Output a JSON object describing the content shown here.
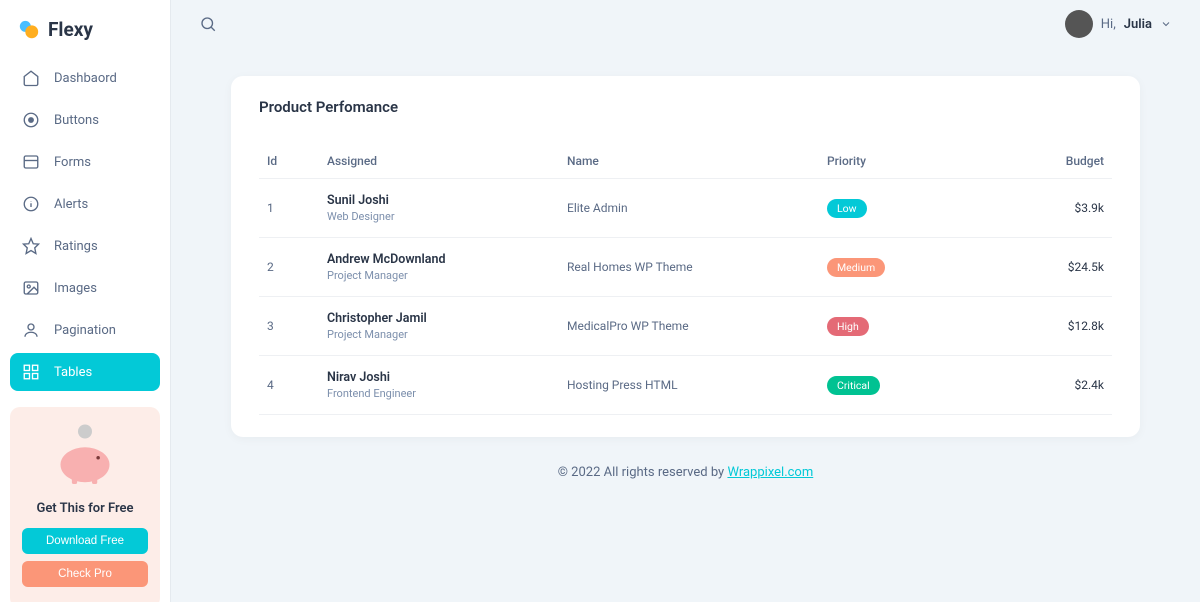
{
  "brand": "Flexy",
  "sidebar": {
    "items": [
      {
        "label": "Dashbaord",
        "icon": "home"
      },
      {
        "label": "Buttons",
        "icon": "target"
      },
      {
        "label": "Forms",
        "icon": "layout"
      },
      {
        "label": "Alerts",
        "icon": "info"
      },
      {
        "label": "Ratings",
        "icon": "star"
      },
      {
        "label": "Images",
        "icon": "image"
      },
      {
        "label": "Pagination",
        "icon": "user"
      },
      {
        "label": "Tables",
        "icon": "grid"
      }
    ],
    "active_index": 7,
    "promo": {
      "title": "Get This for Free",
      "download": "Download Free",
      "check": "Check Pro"
    }
  },
  "header": {
    "greeting": "Hi,",
    "username": "Julia"
  },
  "card": {
    "title": "Product Perfomance",
    "columns": [
      "Id",
      "Assigned",
      "Name",
      "Priority",
      "Budget"
    ],
    "rows": [
      {
        "id": "1",
        "name": "Sunil Joshi",
        "role": "Web Designer",
        "project": "Elite Admin",
        "priority": "Low",
        "priority_color": "#03c9d7",
        "budget": "$3.9k"
      },
      {
        "id": "2",
        "name": "Andrew McDownland",
        "role": "Project Manager",
        "project": "Real Homes WP Theme",
        "priority": "Medium",
        "priority_color": "#fb9678",
        "budget": "$24.5k"
      },
      {
        "id": "3",
        "name": "Christopher Jamil",
        "role": "Project Manager",
        "project": "MedicalPro WP Theme",
        "priority": "High",
        "priority_color": "#e46a76",
        "budget": "$12.8k"
      },
      {
        "id": "4",
        "name": "Nirav Joshi",
        "role": "Frontend Engineer",
        "project": "Hosting Press HTML",
        "priority": "Critical",
        "priority_color": "#00c292",
        "budget": "$2.4k"
      }
    ]
  },
  "footer": {
    "text": "© 2022 All rights reserved by ",
    "link_text": "Wrappixel.com"
  }
}
